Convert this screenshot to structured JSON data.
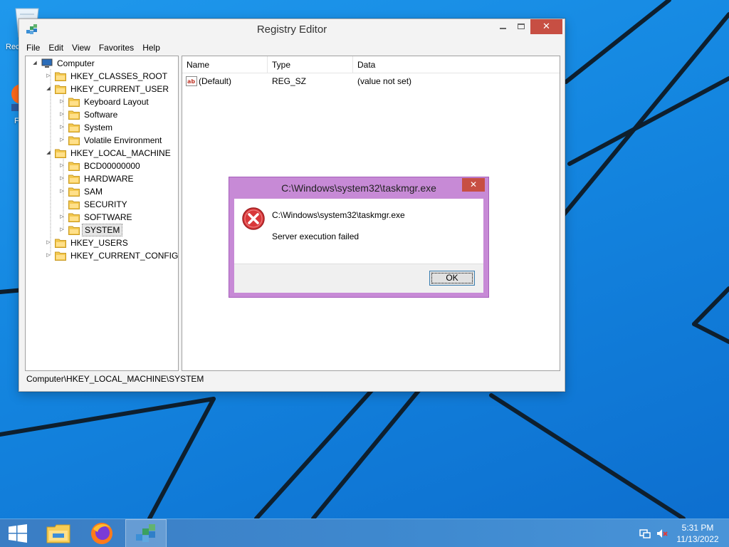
{
  "desktop": {
    "icons": [
      {
        "label": "Rec",
        "icon": "recycle-bin-icon"
      },
      {
        "label": "F",
        "icon": "firefox-icon"
      }
    ]
  },
  "registry_editor": {
    "title": "Registry Editor",
    "caption_buttons": {
      "minimize": "minimize",
      "maximize": "maximize",
      "close": "✕"
    },
    "menu": [
      "File",
      "Edit",
      "View",
      "Favorites",
      "Help"
    ],
    "tree": [
      {
        "label": "Computer",
        "level": 0,
        "expander": "◢",
        "icon": "computer-icon"
      },
      {
        "label": "HKEY_CLASSES_ROOT",
        "level": 1,
        "expander": "▷",
        "icon": "folder-icon"
      },
      {
        "label": "HKEY_CURRENT_USER",
        "level": 1,
        "expander": "◢",
        "icon": "folder-icon"
      },
      {
        "label": "Keyboard Layout",
        "level": 2,
        "expander": "▷",
        "icon": "folder-icon"
      },
      {
        "label": "Software",
        "level": 2,
        "expander": "▷",
        "icon": "folder-icon"
      },
      {
        "label": "System",
        "level": 2,
        "expander": "▷",
        "icon": "folder-icon"
      },
      {
        "label": "Volatile Environment",
        "level": 2,
        "expander": "▷",
        "icon": "folder-icon"
      },
      {
        "label": "HKEY_LOCAL_MACHINE",
        "level": 1,
        "expander": "◢",
        "icon": "folder-icon"
      },
      {
        "label": "BCD00000000",
        "level": 2,
        "expander": "▷",
        "icon": "folder-icon"
      },
      {
        "label": "HARDWARE",
        "level": 2,
        "expander": "▷",
        "icon": "folder-icon"
      },
      {
        "label": "SAM",
        "level": 2,
        "expander": "▷",
        "icon": "folder-icon"
      },
      {
        "label": "SECURITY",
        "level": 2,
        "expander": "",
        "icon": "folder-icon"
      },
      {
        "label": "SOFTWARE",
        "level": 2,
        "expander": "▷",
        "icon": "folder-icon"
      },
      {
        "label": "SYSTEM",
        "level": 2,
        "expander": "▷",
        "icon": "folder-icon",
        "selected": true
      },
      {
        "label": "HKEY_USERS",
        "level": 1,
        "expander": "▷",
        "icon": "folder-icon"
      },
      {
        "label": "HKEY_CURRENT_CONFIG",
        "level": 1,
        "expander": "▷",
        "icon": "folder-icon"
      }
    ],
    "list": {
      "columns": [
        "Name",
        "Type",
        "Data"
      ],
      "rows": [
        {
          "name": "(Default)",
          "type": "REG_SZ",
          "data": "(value not set)",
          "icon": "string-value-icon"
        }
      ]
    },
    "status": "Computer\\HKEY_LOCAL_MACHINE\\SYSTEM"
  },
  "error_dialog": {
    "title": "C:\\Windows\\system32\\taskmgr.exe",
    "close": "✕",
    "icon": "error-icon",
    "message_path": "C:\\Windows\\system32\\taskmgr.exe",
    "message": "Server execution failed",
    "ok_label": "OK"
  },
  "taskbar": {
    "buttons": [
      {
        "name": "start",
        "icon": "windows-logo-icon"
      },
      {
        "name": "file-explorer",
        "icon": "file-explorer-icon"
      },
      {
        "name": "firefox",
        "icon": "firefox-icon"
      },
      {
        "name": "registry-editor",
        "icon": "registry-editor-icon",
        "active": true
      }
    ],
    "tray": {
      "network_icon": "network-icon",
      "volume_icon": "volume-muted-icon"
    },
    "clock": {
      "time": "5:31 PM",
      "date": "11/13/2022"
    }
  },
  "colors": {
    "desktop_blue": "#1486e0",
    "taskbar": "#3f8ad0",
    "dialog_frame": "#c78ad6",
    "close_red": "#c74f43"
  }
}
